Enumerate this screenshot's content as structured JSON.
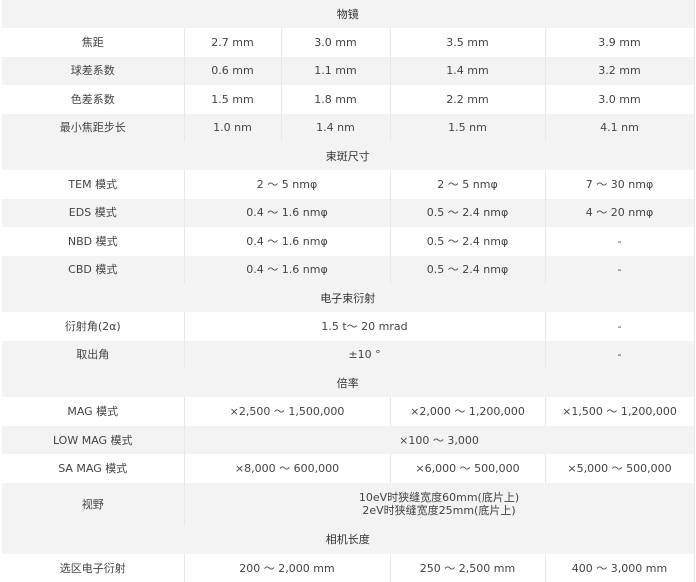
{
  "sections": [
    {
      "title": "物镜",
      "rows": [
        {
          "label": "焦距",
          "cells": [
            {
              "text": "2.7 mm",
              "span": 1
            },
            {
              "text": "3.0 mm",
              "span": 1
            },
            {
              "text": "3.5 mm",
              "span": 1
            },
            {
              "text": "3.9 mm",
              "span": 1
            }
          ]
        },
        {
          "label": "球差系数",
          "cells": [
            {
              "text": "0.6 mm",
              "span": 1
            },
            {
              "text": "1.1 mm",
              "span": 1
            },
            {
              "text": "1.4 mm",
              "span": 1
            },
            {
              "text": "3.2 mm",
              "span": 1
            }
          ]
        },
        {
          "label": "色差系数",
          "cells": [
            {
              "text": "1.5 mm",
              "span": 1
            },
            {
              "text": "1.8 mm",
              "span": 1
            },
            {
              "text": "2.2 mm",
              "span": 1
            },
            {
              "text": "3.0 mm",
              "span": 1
            }
          ]
        },
        {
          "label": "最小焦距步长",
          "cells": [
            {
              "text": "1.0 nm",
              "span": 1
            },
            {
              "text": "1.4 nm",
              "span": 1
            },
            {
              "text": "1.5 nm",
              "span": 1
            },
            {
              "text": "4.1 nm",
              "span": 1
            }
          ]
        }
      ]
    },
    {
      "title": "束斑尺寸",
      "rows": [
        {
          "label": "TEM 模式",
          "cells": [
            {
              "text": "2 ～ 5 nmφ",
              "span": 2
            },
            {
              "text": "2 ～ 5 nmφ",
              "span": 1
            },
            {
              "text": "7 ～ 30 nmφ",
              "span": 1
            }
          ]
        },
        {
          "label": "EDS 模式",
          "cells": [
            {
              "text": "0.4 ～ 1.6 nmφ",
              "span": 2
            },
            {
              "text": "0.5 ～ 2.4 nmφ",
              "span": 1
            },
            {
              "text": "4 ～ 20 nmφ",
              "span": 1
            }
          ]
        },
        {
          "label": "NBD 模式",
          "cells": [
            {
              "text": "0.4 ～ 1.6 nmφ",
              "span": 2
            },
            {
              "text": "0.5 ～ 2.4 nmφ",
              "span": 1
            },
            {
              "text": "-",
              "span": 1
            }
          ]
        },
        {
          "label": "CBD 模式",
          "cells": [
            {
              "text": "0.4 ～ 1.6 nmφ",
              "span": 2
            },
            {
              "text": "0.5 ～ 2.4 nmφ",
              "span": 1
            },
            {
              "text": "-",
              "span": 1
            }
          ]
        }
      ]
    },
    {
      "title": "电子束衍射",
      "rows": [
        {
          "label": "衍射角(2α)",
          "cells": [
            {
              "text": "1.5 t～ 20 mrad",
              "span": 3
            },
            {
              "text": "-",
              "span": 1
            }
          ]
        },
        {
          "label": "取出角",
          "cells": [
            {
              "text": "±10 °",
              "span": 3
            },
            {
              "text": "-",
              "span": 1
            }
          ]
        }
      ]
    },
    {
      "title": "倍率",
      "rows": [
        {
          "label": "MAG 模式",
          "cells": [
            {
              "text": "×2,500 ～ 1,500,000",
              "span": 2
            },
            {
              "text": "×2,000 ～ 1,200,000",
              "span": 1
            },
            {
              "text": "×1,500 ～ 1,200,000",
              "span": 1
            }
          ]
        },
        {
          "label": "LOW MAG 模式",
          "cells": [
            {
              "text": "×100 ～ 3,000",
              "span": 4
            }
          ]
        },
        {
          "label": "SA MAG 模式",
          "cells": [
            {
              "text": "×8,000 ～ 600,000",
              "span": 2
            },
            {
              "text": "×6,000 ～ 500,000",
              "span": 1
            },
            {
              "text": "×5,000 ～ 500,000",
              "span": 1
            }
          ]
        },
        {
          "label": "视野",
          "cells": [
            {
              "lines": [
                "10eV时狭缝宽度60mm(底片上)",
                "2eV时狭缝宽度25mm(底片上)"
              ],
              "span": 4
            }
          ]
        }
      ]
    },
    {
      "title": "相机长度",
      "rows": [
        {
          "label": "选区电子衍射",
          "cells": [
            {
              "text": "200 ～ 2,000 mm",
              "span": 2
            },
            {
              "text": "250 ～ 2,500 mm",
              "span": 1
            },
            {
              "text": "400 ～ 3,000 mm",
              "span": 1
            }
          ]
        }
      ]
    }
  ]
}
